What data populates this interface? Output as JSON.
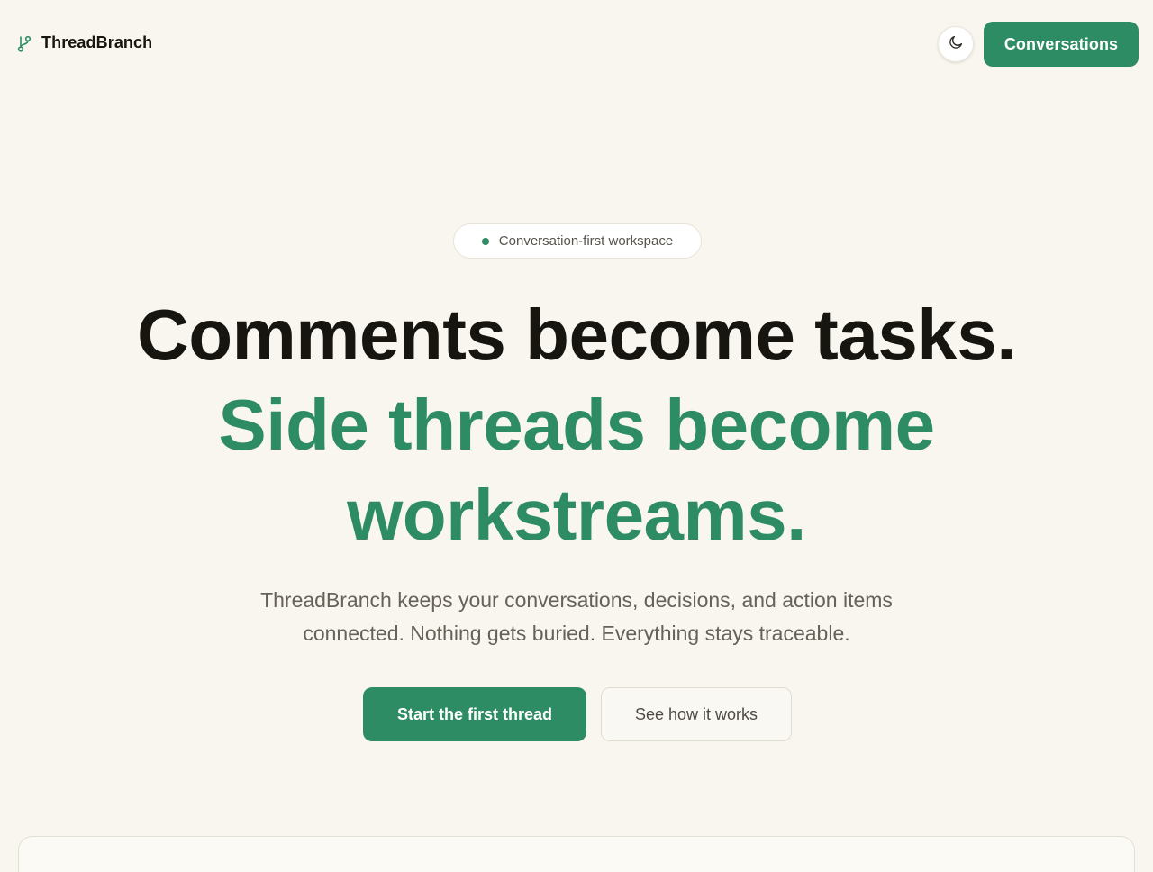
{
  "brand": {
    "name": "ThreadBranch",
    "icon": "git-branch-icon"
  },
  "header": {
    "theme_toggle_icon": "moon-icon",
    "cta_label": "Conversations"
  },
  "hero": {
    "badge": "Conversation-first workspace",
    "headline_part1": "Comments become tasks.",
    "headline_part2": "Side threads become workstreams.",
    "subheadline": "ThreadBranch keeps your conversations, decisions, and action items connected. Nothing gets buried. Everything stays traceable.",
    "primary_button": "Start the first thread",
    "secondary_button": "See how it works"
  },
  "colors": {
    "background": "#f9f6ef",
    "accent": "#2e8c64",
    "text_primary": "#17150f",
    "text_secondary": "#66625a"
  }
}
